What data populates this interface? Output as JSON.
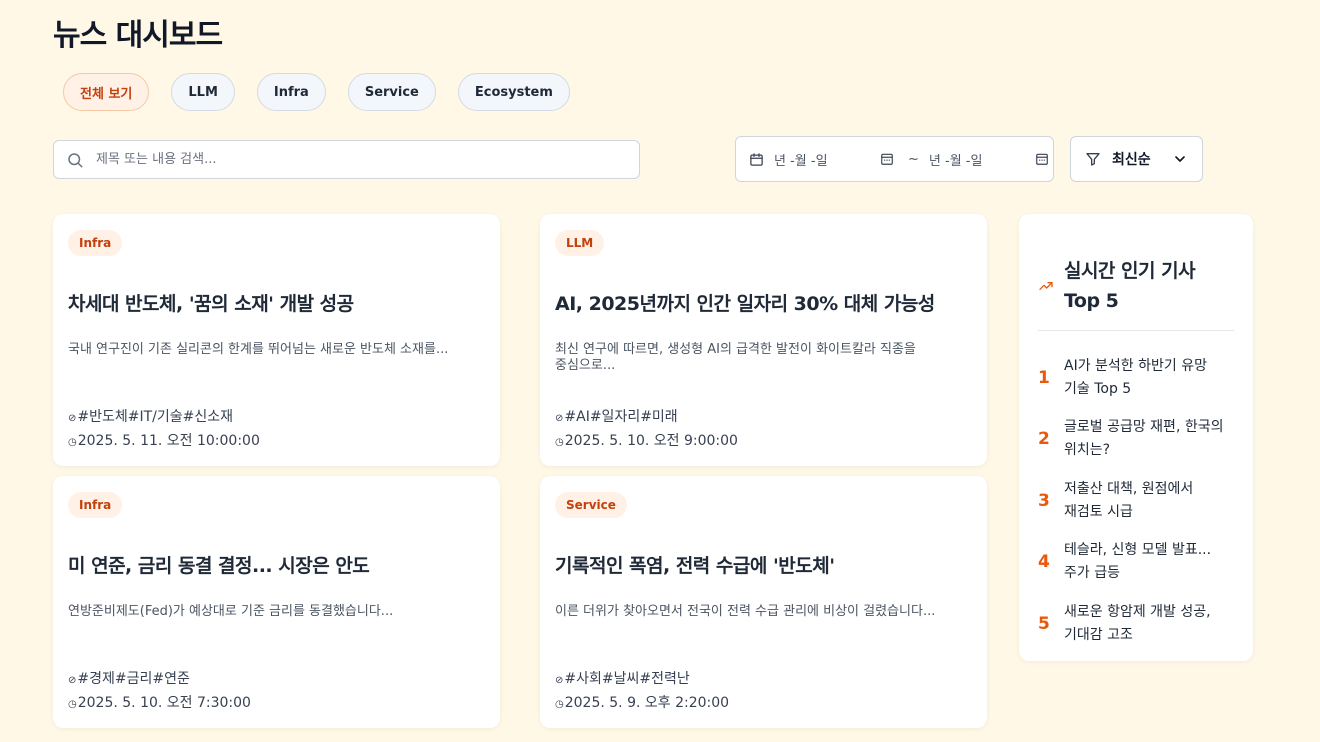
{
  "page": {
    "title": "뉴스 대시보드"
  },
  "filters": [
    {
      "label": "전체 보기",
      "active": true
    },
    {
      "label": "LLM",
      "active": false
    },
    {
      "label": "Infra",
      "active": false
    },
    {
      "label": "Service",
      "active": false
    },
    {
      "label": "Ecosystem",
      "active": false
    }
  ],
  "search": {
    "placeholder": "제목 또는 내용 검색..."
  },
  "date_range": {
    "start": "년 -월 -일",
    "separator": "~",
    "end": "년 -월 -일"
  },
  "sort": {
    "label": "최신순"
  },
  "articles": [
    {
      "category": "Infra",
      "title": "차세대 반도체, '꿈의 소재' 개발 성공",
      "summary": "국내 연구진이 기존 실리콘의 한계를 뛰어넘는 새로운 반도체 소재를...",
      "tags": "#반도체#IT/기술#신소재",
      "date": "2025. 5. 11. 오전 10:00:00"
    },
    {
      "category": "LLM",
      "title": "AI, 2025년까지 인간 일자리 30% 대체 가능성",
      "summary": "최신 연구에 따르면, 생성형 AI의 급격한 발전이 화이트칼라 직종을 중심으로...",
      "tags": "#AI#일자리#미래",
      "date": "2025. 5. 10. 오전 9:00:00"
    },
    {
      "category": "Infra",
      "title": "미 연준, 금리 동결 결정... 시장은 안도",
      "summary": "연방준비제도(Fed)가 예상대로 기준 금리를 동결했습니다...",
      "tags": "#경제#금리#연준",
      "date": "2025. 5. 10. 오전 7:30:00"
    },
    {
      "category": "Service",
      "title": "기록적인 폭염, 전력 수급에 '반도체'",
      "summary": "이른 더위가 찾아오면서 전국이 전력 수급 관리에 비상이 걸렸습니다...",
      "tags": "#사회#날씨#전력난",
      "date": "2025. 5. 9. 오후 2:20:00"
    }
  ],
  "popular": {
    "title": "실시간 인기 기사 Top 5",
    "items": [
      {
        "rank": "1",
        "title": "AI가 분석한 하반기 유망 기술 Top 5"
      },
      {
        "rank": "2",
        "title": "글로벌 공급망 재편, 한국의 위치는?"
      },
      {
        "rank": "3",
        "title": "저출산 대책, 원점에서 재검토 시급"
      },
      {
        "rank": "4",
        "title": "테슬라, 신형 모델 발표... 주가 급등"
      },
      {
        "rank": "5",
        "title": "새로운 항암제 개발 성공, 기대감 고조"
      }
    ]
  },
  "colors": {
    "background": "#fff8e7",
    "accent": "#ea580c",
    "badge_bg": "#fff1e6",
    "badge_text": "#c2410c"
  },
  "icons": {
    "search": "search-icon",
    "calendar": "calendar-icon",
    "filter": "filter-icon",
    "chevron": "chevron-down-icon",
    "trending": "trending-up-icon",
    "tag": "tag-icon",
    "clock": "clock-icon"
  }
}
